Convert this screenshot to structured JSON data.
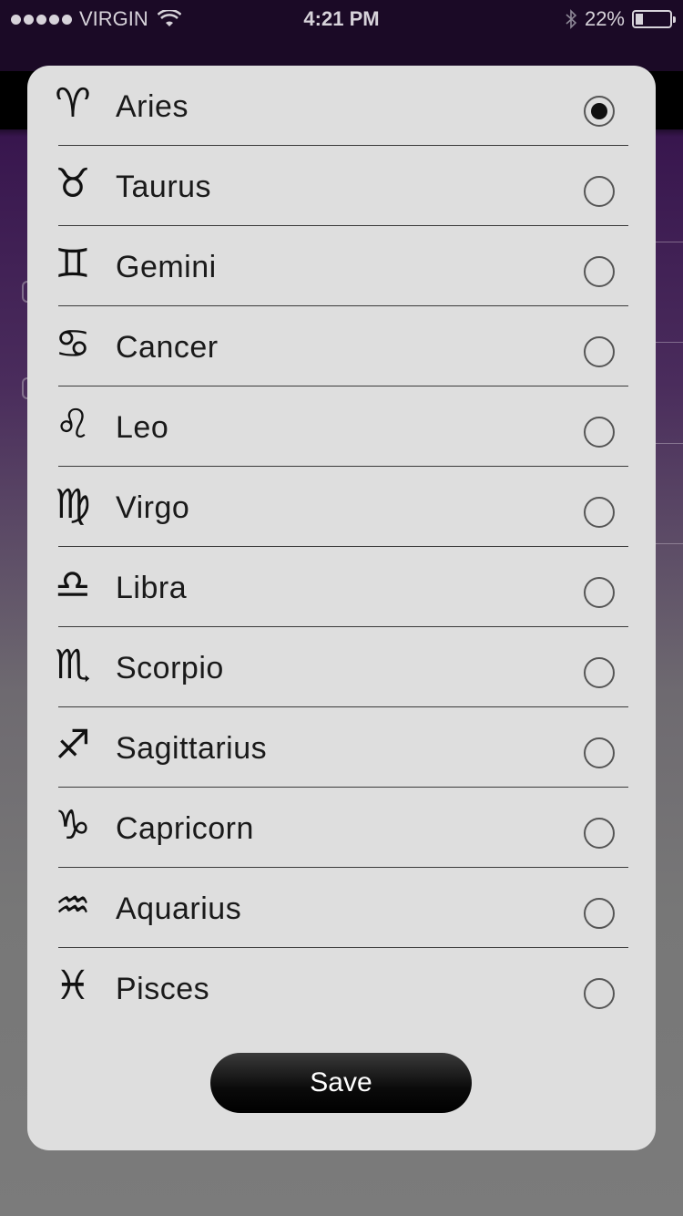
{
  "status_bar": {
    "carrier": "VIRGIN",
    "time": "4:21 PM",
    "battery": "22%",
    "battery_level": 0.22,
    "icons": [
      "signal-dots-icon",
      "wifi-icon",
      "bluetooth-icon",
      "battery-icon"
    ]
  },
  "signs": [
    {
      "label": "Aries",
      "symbol": "♈︎",
      "icon": "aries-icon",
      "selected": true
    },
    {
      "label": "Taurus",
      "symbol": "♉︎",
      "icon": "taurus-icon",
      "selected": false
    },
    {
      "label": "Gemini",
      "symbol": "♊︎",
      "icon": "gemini-icon",
      "selected": false
    },
    {
      "label": "Cancer",
      "symbol": "♋︎",
      "icon": "cancer-icon",
      "selected": false
    },
    {
      "label": "Leo",
      "symbol": "♌︎",
      "icon": "leo-icon",
      "selected": false
    },
    {
      "label": "Virgo",
      "symbol": "♍︎",
      "icon": "virgo-icon",
      "selected": false
    },
    {
      "label": "Libra",
      "symbol": "♎︎",
      "icon": "libra-icon",
      "selected": false
    },
    {
      "label": "Scorpio",
      "symbol": "♏︎",
      "icon": "scorpio-icon",
      "selected": false
    },
    {
      "label": "Sagittarius",
      "symbol": "♐︎",
      "icon": "sagittarius-icon",
      "selected": false
    },
    {
      "label": "Capricorn",
      "symbol": "♑︎",
      "icon": "capricorn-icon",
      "selected": false
    },
    {
      "label": "Aquarius",
      "symbol": "♒︎",
      "icon": "aquarius-icon",
      "selected": false
    },
    {
      "label": "Pisces",
      "symbol": "♓︎",
      "icon": "pisces-icon",
      "selected": false
    }
  ],
  "save_button": {
    "label": "Save"
  },
  "colors": {
    "modal_background": "#dedede",
    "radio_selected": "#111111",
    "button_background": "#000000",
    "button_text": "#ffffff"
  }
}
